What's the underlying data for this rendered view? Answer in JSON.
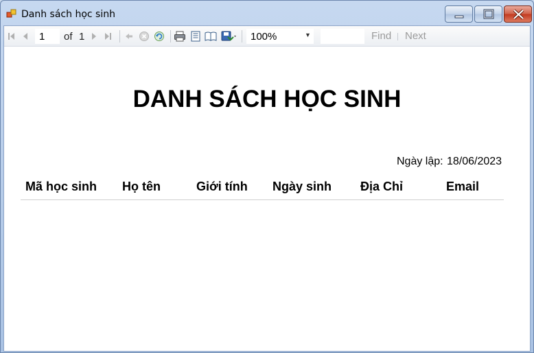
{
  "window": {
    "title": "Danh sách học sinh"
  },
  "toolbar": {
    "current_page": "1",
    "of_label": "of",
    "total_pages": "1",
    "zoom": "100%",
    "find_text": "",
    "find_label": "Find",
    "next_label": "Next"
  },
  "report": {
    "title": "DANH SÁCH HỌC SINH",
    "date_label": "Ngày lập:",
    "date_value": "18/06/2023",
    "columns": [
      "Mã học sinh",
      "Họ tên",
      "Giới tính",
      "Ngày sinh",
      "Địa Chỉ",
      "Email"
    ]
  },
  "colors": {
    "titlebar": "#b9cfec",
    "close_button": "#c9432a",
    "report_background": "#ffffff"
  }
}
